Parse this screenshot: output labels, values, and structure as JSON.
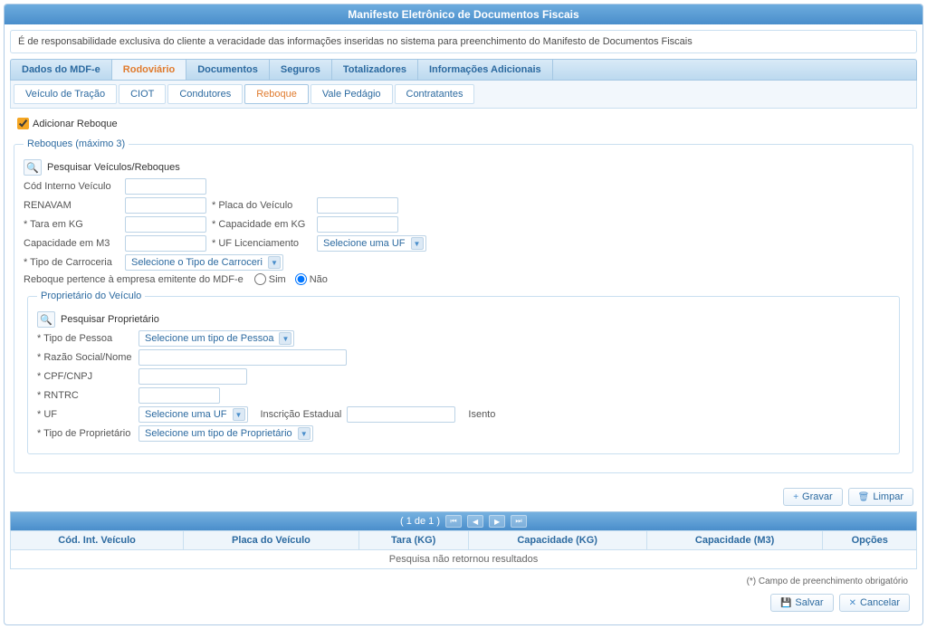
{
  "header": {
    "title": "Manifesto Eletrônico de Documentos Fiscais"
  },
  "notice": "É de responsabilidade exclusiva do cliente a veracidade das informações inseridas no sistema para preenchimento do Manifesto de Documentos Fiscais",
  "tabs": {
    "dados": "Dados do MDF-e",
    "rodoviario": "Rodoviário",
    "documentos": "Documentos",
    "seguros": "Seguros",
    "totalizadores": "Totalizadores",
    "info": "Informações Adicionais"
  },
  "subtabs": {
    "veiculo": "Veículo de Tração",
    "ciot": "CIOT",
    "condutores": "Condutores",
    "reboque": "Reboque",
    "vale": "Vale Pedágio",
    "contratantes": "Contratantes"
  },
  "checkbox": {
    "label": "Adicionar Reboque"
  },
  "reboques": {
    "legend": "Reboques (máximo 3)",
    "search_btn": "🔍",
    "search_label": "Pesquisar Veículos/Reboques",
    "cod_interno": "Cód Interno Veículo",
    "renavam": "RENAVAM",
    "placa": "* Placa do Veículo",
    "tara": "* Tara em KG",
    "capacidade_kg": "* Capacidade em KG",
    "capacidade_m3": "Capacidade em M3",
    "uf_lic": "* UF Licenciamento",
    "uf_lic_select": "Selecione uma UF",
    "tipo_carroceria": "* Tipo de Carroceria",
    "tipo_carroceria_select": "Selecione o Tipo de Carroceri",
    "reboque_emitente": "Reboque pertence à empresa emitente do MDF-e",
    "sim": "Sim",
    "nao": "Não"
  },
  "proprietario": {
    "legend": "Proprietário do Veículo",
    "search_label": "Pesquisar Proprietário",
    "tipo_pessoa": "* Tipo de Pessoa",
    "tipo_pessoa_select": "Selecione um tipo de Pessoa",
    "razao": "* Razão Social/Nome",
    "cpf": "* CPF/CNPJ",
    "rntrc": "* RNTRC",
    "uf": "* UF",
    "uf_select": "Selecione uma UF",
    "inscricao": "Inscrição Estadual",
    "isento": "Isento",
    "tipo_prop": "* Tipo de Proprietário",
    "tipo_prop_select": "Selecione um tipo de Proprietário"
  },
  "buttons": {
    "gravar": "Gravar",
    "limpar": "Limpar",
    "salvar": "Salvar",
    "cancelar": "Cancelar"
  },
  "pager": {
    "text": "( 1 de 1 )"
  },
  "grid": {
    "cols": {
      "cod": "Cód. Int. Veículo",
      "placa": "Placa do Veículo",
      "tara": "Tara (KG)",
      "cap_kg": "Capacidade (KG)",
      "cap_m3": "Capacidade (M3)",
      "opcoes": "Opções"
    },
    "empty": "Pesquisa não retornou resultados"
  },
  "footer_note": "(*) Campo de preenchimento obrigatório"
}
